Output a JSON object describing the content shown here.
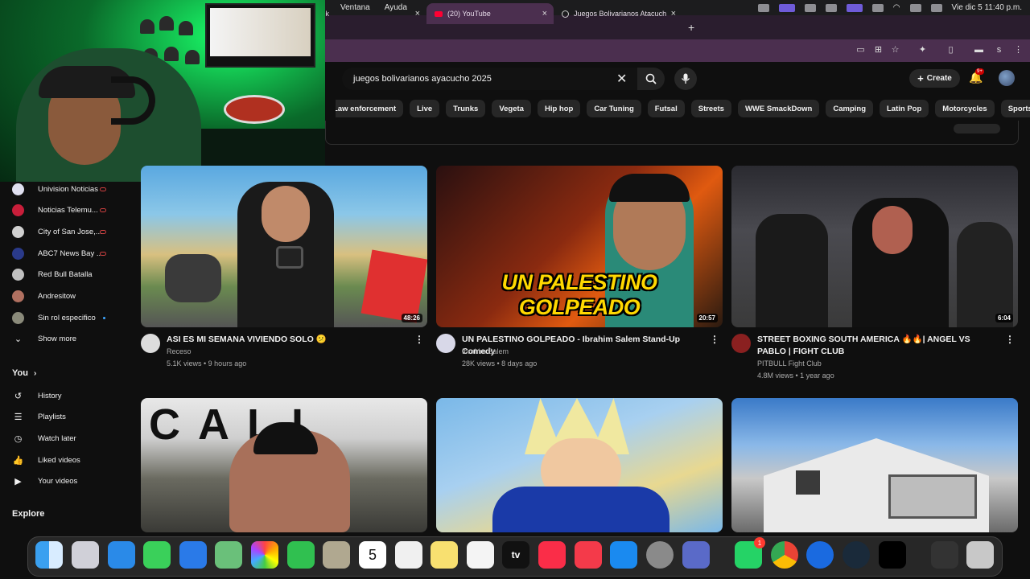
{
  "menubar": {
    "items": [
      "Ventana",
      "Ayuda"
    ],
    "clock": "Vie dic 5  11:40 p.m."
  },
  "tabs": [
    {
      "title": "ck",
      "active": false
    },
    {
      "title": "(20) YouTube",
      "active": true
    },
    {
      "title": "Juegos Bolivarianos Atacuch",
      "active": false
    }
  ],
  "toolbar": {
    "profile_initial": "s"
  },
  "header": {
    "search_query": "juegos bolivarianos ayacucho 2025",
    "create_label": "Create",
    "notification_badge": "9+"
  },
  "chips": [
    "Law enforcement",
    "Live",
    "Trunks",
    "Vegeta",
    "Hip hop",
    "Car Tuning",
    "Futsal",
    "Streets",
    "WWE SmackDown",
    "Camping",
    "Latin Pop",
    "Motorcycles",
    "Sports tournam"
  ],
  "sidebar": {
    "subscriptions": [
      {
        "label": "Univision Noticias",
        "indicator": "live"
      },
      {
        "label": "Noticias Telemu...",
        "indicator": "live"
      },
      {
        "label": "City of San Jose,...",
        "indicator": "live"
      },
      {
        "label": "ABC7 News Bay ...",
        "indicator": "live"
      },
      {
        "label": "Red Bull Batalla",
        "indicator": ""
      },
      {
        "label": "Andresitow",
        "indicator": ""
      },
      {
        "label": "Sin rol especifico",
        "indicator": "new"
      }
    ],
    "show_more": "Show more",
    "you_heading": "You",
    "you_items": [
      {
        "label": "History",
        "icon": "history-icon"
      },
      {
        "label": "Playlists",
        "icon": "playlists-icon"
      },
      {
        "label": "Watch later",
        "icon": "watch-later-icon"
      },
      {
        "label": "Liked videos",
        "icon": "thumbs-up-icon"
      },
      {
        "label": "Your videos",
        "icon": "your-videos-icon"
      }
    ],
    "explore_heading": "Explore"
  },
  "videos": [
    {
      "title": "ASI ES MI SEMANA VIVIENDO SOLO 😕",
      "channel": "Receso",
      "meta": "5.1K views • 9 hours ago",
      "duration": "48:26",
      "thumb_text": ""
    },
    {
      "title": "UN PALESTINO GOLPEADO - Ibrahim Salem Stand-Up Comedy",
      "channel": "Ibrahim Salem",
      "meta": "28K views • 8 days ago",
      "duration": "20:57",
      "thumb_text": "UN PALESTINO GOLPEADO"
    },
    {
      "title": "STREET BOXING SOUTH AMERICA 🔥🔥| ANGEL VS PABLO | FIGHT CLUB",
      "channel": "PITBULL Fight Club",
      "meta": "4.8M views • 1 year ago",
      "duration": "6:04",
      "thumb_text": ""
    },
    {
      "title": "",
      "channel": "",
      "meta": "",
      "duration": "",
      "thumb_text": "CALI"
    },
    {
      "title": "",
      "channel": "",
      "meta": "",
      "duration": "",
      "thumb_text": ""
    },
    {
      "title": "",
      "channel": "",
      "meta": "",
      "duration": "",
      "thumb_text": ""
    }
  ],
  "dock": {
    "apps": [
      "finder",
      "launchpad",
      "safari",
      "messages",
      "mail",
      "maps",
      "photos",
      "facetime",
      "contacts",
      "calendar",
      "reminders",
      "notes",
      "freeform",
      "apple-tv",
      "music",
      "news",
      "app-store",
      "system-settings",
      "preview",
      "whatsapp",
      "chrome",
      "quicktime",
      "screen-recorder",
      "capcut",
      "photo-stack",
      "trash"
    ],
    "calendar_day": "5",
    "whatsapp_badge": "1"
  },
  "colors": {
    "accent_red": "#ff0033",
    "tab_bg": "#4b2f4f",
    "background": "#0f0f0f"
  }
}
